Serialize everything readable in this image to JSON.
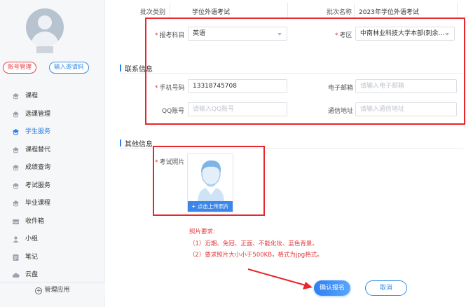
{
  "sidebar": {
    "account_btn": "账号管理",
    "invite_btn": "输入邀请码",
    "items": [
      {
        "label": "课程",
        "icon": "course-icon"
      },
      {
        "label": "选课管理",
        "icon": "course-select-icon"
      },
      {
        "label": "学生服务",
        "icon": "student-service-icon"
      },
      {
        "label": "课程替代",
        "icon": "course-substitute-icon"
      },
      {
        "label": "成绩查询",
        "icon": "grade-query-icon"
      },
      {
        "label": "考试服务",
        "icon": "exam-service-icon"
      },
      {
        "label": "毕业课程",
        "icon": "graduate-course-icon"
      },
      {
        "label": "收件箱",
        "icon": "inbox-icon"
      },
      {
        "label": "小组",
        "icon": "group-icon"
      },
      {
        "label": "笔记",
        "icon": "note-icon"
      },
      {
        "label": "云盘",
        "icon": "cloud-icon"
      }
    ],
    "active_index": 2,
    "manage_label": "管理应用"
  },
  "form": {
    "batch_type_label": "批次类别",
    "batch_type_value": "学位外语考试",
    "batch_name_label": "批次名称",
    "batch_name_value": "2023年学位外语考试",
    "subject_label": "报考科目",
    "subject_value": "英语",
    "exam_area_label": "考区",
    "exam_area_value": "中南林业科技大学本部(刺余...",
    "contact_section": "联系信息",
    "phone_label": "手机号码",
    "phone_value": "13318745708",
    "email_label": "电子邮箱",
    "email_placeholder": "请输入电子邮箱",
    "qq_label": "QQ账号",
    "qq_placeholder": "请输入QQ账号",
    "address_label": "通信地址",
    "address_placeholder": "请输入通信地址",
    "other_section": "其他信息",
    "photo_label": "考试照片",
    "upload_label": "+ 点击上传照片",
    "photo_req_title": "照片要求:",
    "photo_req_1": "（1）近期、免冠、正面、不能化妆、蓝色背景。",
    "photo_req_2": "（2）要求照片大小小于500KB，格式为jpg格式。",
    "required_mark": "*"
  },
  "actions": {
    "confirm": "确认报名",
    "cancel": "取消"
  },
  "colors": {
    "accent": "#2d7fe6",
    "highlight": "#e8262c",
    "required": "#e4393c"
  }
}
